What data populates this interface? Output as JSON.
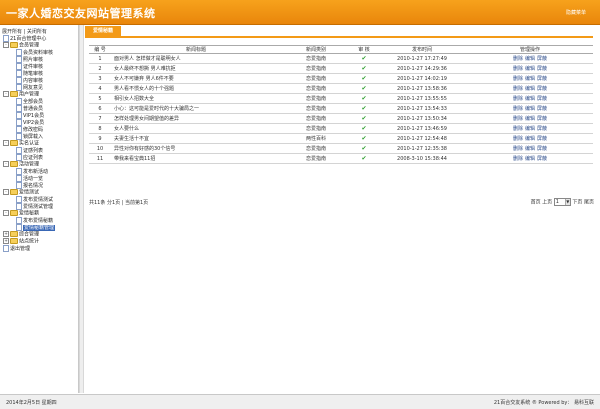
{
  "header": {
    "title": "一家人婚恋交友网站管理系统",
    "logout": "隐藏菜单"
  },
  "left": {
    "expand_all": "展开所有",
    "separator": " | ",
    "collapse_all": "关闭所有",
    "root": "21百合管理中心",
    "tree": [
      {
        "label": "会员管理",
        "level": 1,
        "type": "folder",
        "toggle": "-"
      },
      {
        "label": "会员资料审核",
        "level": 2,
        "type": "page"
      },
      {
        "label": "照片审核",
        "level": 2,
        "type": "page"
      },
      {
        "label": "证件审核",
        "level": 2,
        "type": "page"
      },
      {
        "label": "随笔审核",
        "level": 2,
        "type": "page"
      },
      {
        "label": "内容审核",
        "level": 2,
        "type": "page"
      },
      {
        "label": "网友意见",
        "level": 2,
        "type": "page"
      },
      {
        "label": "用户管理",
        "level": 1,
        "type": "folder",
        "toggle": "-"
      },
      {
        "label": "全部会员",
        "level": 2,
        "type": "page"
      },
      {
        "label": "普通会员",
        "level": 2,
        "type": "page"
      },
      {
        "label": "VIP1会员",
        "level": 2,
        "type": "page"
      },
      {
        "label": "VIP2会员",
        "level": 2,
        "type": "page"
      },
      {
        "label": "修改密码",
        "level": 2,
        "type": "page"
      },
      {
        "label": "锁屏载入",
        "level": 2,
        "type": "page"
      },
      {
        "label": "实名认证",
        "level": 1,
        "type": "folder",
        "toggle": "-"
      },
      {
        "label": "证感列表",
        "level": 2,
        "type": "page"
      },
      {
        "label": "应证列表",
        "level": 2,
        "type": "page"
      },
      {
        "label": "活动管理",
        "level": 1,
        "type": "folder",
        "toggle": "-"
      },
      {
        "label": "发布新活动",
        "level": 2,
        "type": "page"
      },
      {
        "label": "活动一览",
        "level": 2,
        "type": "page"
      },
      {
        "label": "报名情况",
        "level": 2,
        "type": "page"
      },
      {
        "label": "爱情测试",
        "level": 1,
        "type": "folder",
        "toggle": "-"
      },
      {
        "label": "发布爱情测试",
        "level": 2,
        "type": "page"
      },
      {
        "label": "爱情测试管理",
        "level": 2,
        "type": "page"
      },
      {
        "label": "爱情秘籍",
        "level": 1,
        "type": "folder",
        "toggle": "-"
      },
      {
        "label": "发布爱情秘籍",
        "level": 2,
        "type": "page"
      },
      {
        "label": "爱情秘籍管理",
        "level": 2,
        "type": "page",
        "selected": true
      },
      {
        "label": "综合管理",
        "level": 1,
        "type": "folder",
        "toggle": "+"
      },
      {
        "label": "站点统计",
        "level": 1,
        "type": "folder",
        "toggle": "+"
      },
      {
        "label": "退出管理",
        "level": 1,
        "type": "page"
      }
    ]
  },
  "main": {
    "tab": "爱情秘籍",
    "columns": [
      "编 号",
      "新闻标题",
      "新闻类别",
      "审 核",
      "发布时间",
      "管理操作"
    ],
    "rows": [
      {
        "id": "1",
        "title": "面对男人 怎样做才是聪明女人",
        "cat": "恋爱指南",
        "audit": "✔",
        "time": "2010-1-27 17:27:49"
      },
      {
        "id": "2",
        "title": "女人最终不想撕 男人难抗拒",
        "cat": "恋爱指南",
        "audit": "✔",
        "time": "2010-1-27 14:29:36"
      },
      {
        "id": "3",
        "title": "女人不可嫌弃 男人6件不要",
        "cat": "恋爱指南",
        "audit": "✔",
        "time": "2010-1-27 14:02:19"
      },
      {
        "id": "4",
        "title": "男人看不惯女人的十个强题",
        "cat": "恋爱指南",
        "audit": "✔",
        "time": "2010-1-27 13:58:36"
      },
      {
        "id": "5",
        "title": "相引女人招数大全",
        "cat": "恋爱指南",
        "audit": "✔",
        "time": "2010-1-27 13:55:55"
      },
      {
        "id": "6",
        "title": "小心：这可能是爱时代的十大骗局之一",
        "cat": "恋爱指南",
        "audit": "✔",
        "time": "2010-1-27 13:54:33"
      },
      {
        "id": "7",
        "title": "怎样处理男女间期望值的差异",
        "cat": "恋爱指南",
        "audit": "✔",
        "time": "2010-1-27 13:50:34"
      },
      {
        "id": "8",
        "title": "女人要什么",
        "cat": "恋爱指南",
        "audit": "✔",
        "time": "2010-1-27 13:46:59"
      },
      {
        "id": "9",
        "title": "夫妻生活十不宜",
        "cat": "两性百科",
        "audit": "✔",
        "time": "2010-1-27 12:54:48"
      },
      {
        "id": "10",
        "title": "异性对你有好感的30个信号",
        "cat": "恋爱指南",
        "audit": "✔",
        "time": "2010-1-27 12:35:38"
      },
      {
        "id": "11",
        "title": "带我来看宝典11招",
        "cat": "恋爱指南",
        "audit": "✔",
        "time": "2008-3-10 15:38:44"
      }
    ],
    "ops": [
      "删除",
      "编辑",
      "屏蔽"
    ],
    "pager_left": "共11条 分1页 | 当前第1页",
    "pager_first": "首页",
    "pager_prev": "上页",
    "pager_select": "1",
    "pager_next": "下页",
    "pager_last": "尾页"
  },
  "footer": {
    "date": "2014年2月5日 星期四",
    "right": "21百合交友系统 ® Powered by： 易科互联"
  }
}
